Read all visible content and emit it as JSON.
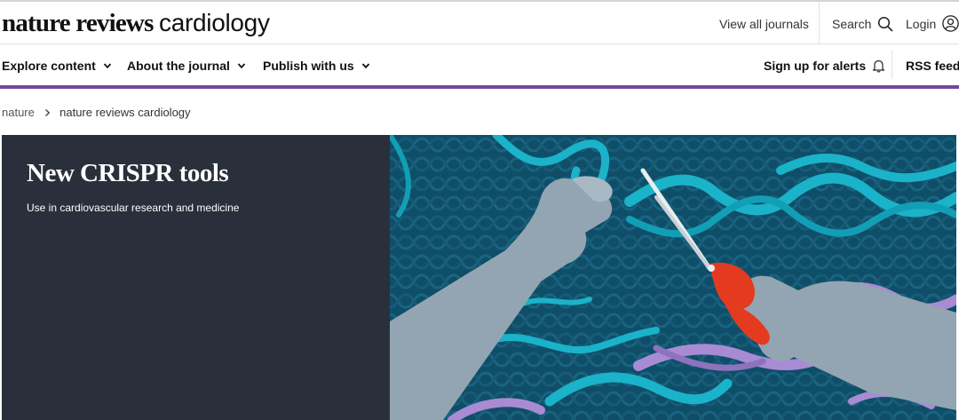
{
  "header": {
    "logo_bold": "nature reviews",
    "logo_light": "cardiology",
    "view_all": "View all journals",
    "search": "Search",
    "login": "Login"
  },
  "nav": {
    "items": [
      {
        "label": "Explore content"
      },
      {
        "label": "About the journal"
      },
      {
        "label": "Publish with us"
      }
    ],
    "alerts": "Sign up for alerts",
    "rss": "RSS feed"
  },
  "breadcrumb": {
    "root": "nature",
    "current": "nature reviews cardiology"
  },
  "hero": {
    "title": "New CRISPR tools",
    "subtitle": "Use in cardiovascular research and medicine",
    "image_alt": "Illustration of two hands cutting a DNA double helix with red-handled scissors"
  },
  "colors": {
    "accent_purple": "#6f4b9a",
    "hero_panel": "#29303b",
    "hero_art_bg": "#0f4e69",
    "dna_cyan": "#1ab3c9",
    "dna_lilac": "#a98bd3",
    "scissors_red": "#e43b20"
  },
  "icons": {
    "search": "magnifier-icon",
    "login": "user-circle-icon",
    "alerts": "bell-icon",
    "chevron": "chevron-down-icon",
    "breadcrumb_sep": "chevron-right-icon"
  }
}
